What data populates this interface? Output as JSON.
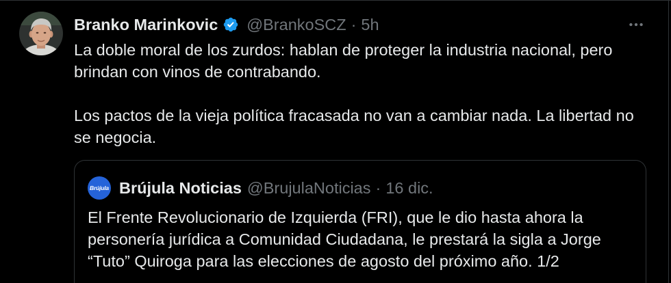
{
  "colors": {
    "background": "#000000",
    "text_primary": "#e7e9ea",
    "text_secondary": "#71767b",
    "verified_badge": "#1d9bf0",
    "border": "#2f3336",
    "quoted_logo": "#2563d9"
  },
  "tweet": {
    "author": {
      "avatar_icon": "user-avatar-photo",
      "name": "Branko Marinkovic",
      "verified_icon": "verified-badge-icon",
      "handle": "@BrankoSCZ",
      "separator": "·",
      "time": "5h"
    },
    "more_icon": "more-horizontal-icon",
    "paragraphs": [
      [
        "La doble moral de los zurdos: hablan de proteger la industria nacional, pero",
        "brindan con vinos de contrabando."
      ],
      [
        "Los pactos de la vieja política fracasada no van a cambiar nada. La libertad no",
        "se negocia."
      ]
    ],
    "quoted_tweet": {
      "logo_text": "Brújula",
      "name": "Brújula Noticias",
      "handle": "@BrujulaNoticias",
      "separator": "·",
      "date": "16 dic.",
      "lines": [
        "El Frente Revolucionario de Izquierda (FRI), que le dio hasta ahora la",
        "personería jurídica a Comunidad Ciudadana, le prestará la sigla a Jorge",
        "“Tuto” Quiroga para las elecciones de agosto del próximo año. 1/2"
      ]
    }
  }
}
